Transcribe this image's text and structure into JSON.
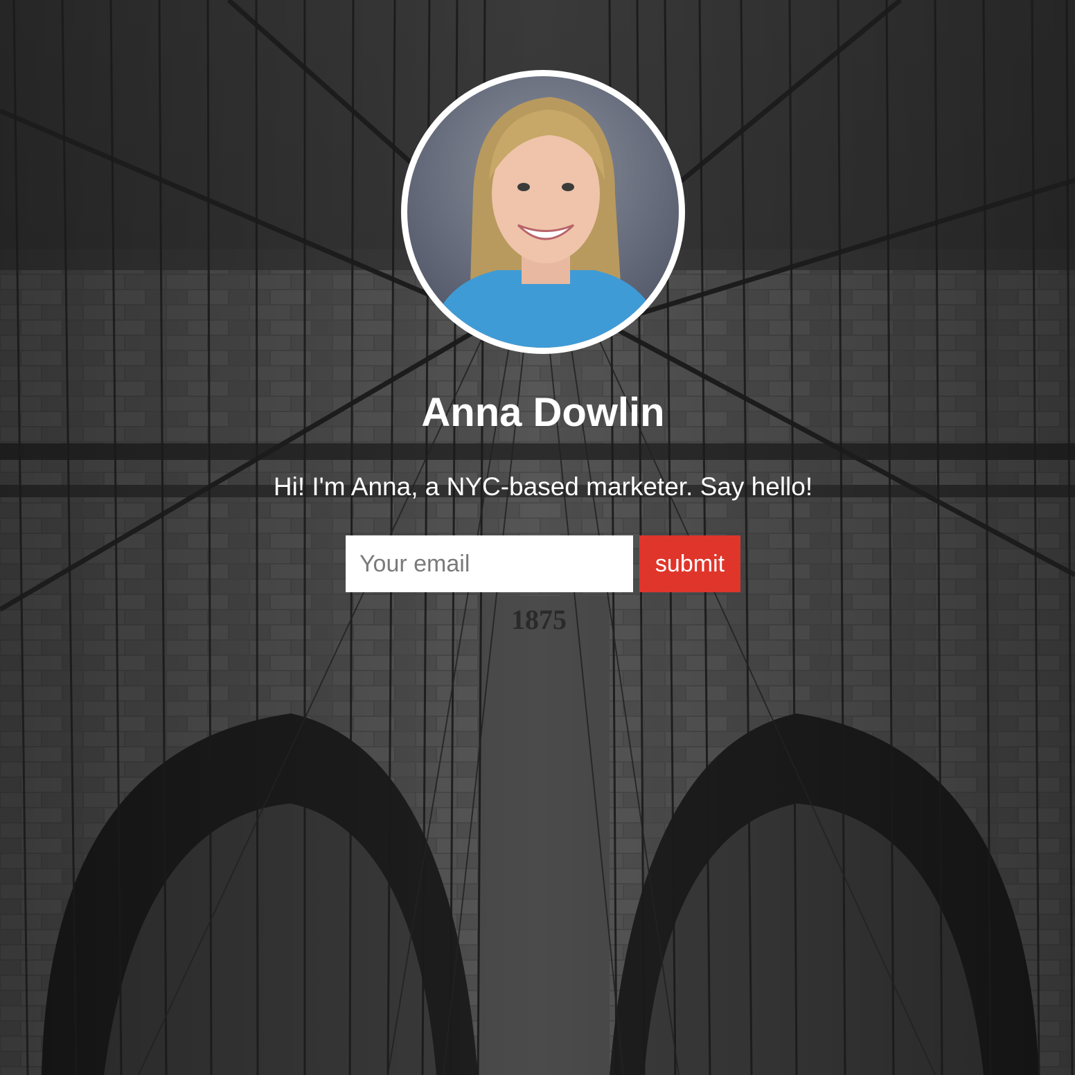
{
  "profile": {
    "name": "Anna Dowlin",
    "tagline": "Hi! I'm Anna, a NYC-based marketer. Say hello!",
    "avatar_icon": "person-photo"
  },
  "signup": {
    "email_placeholder": "Your email",
    "email_value": "",
    "submit_label": "submit"
  },
  "background": {
    "carved_year": "1875"
  },
  "colors": {
    "accent": "#e0352b",
    "text": "#ffffff",
    "input_bg": "#ffffff"
  }
}
